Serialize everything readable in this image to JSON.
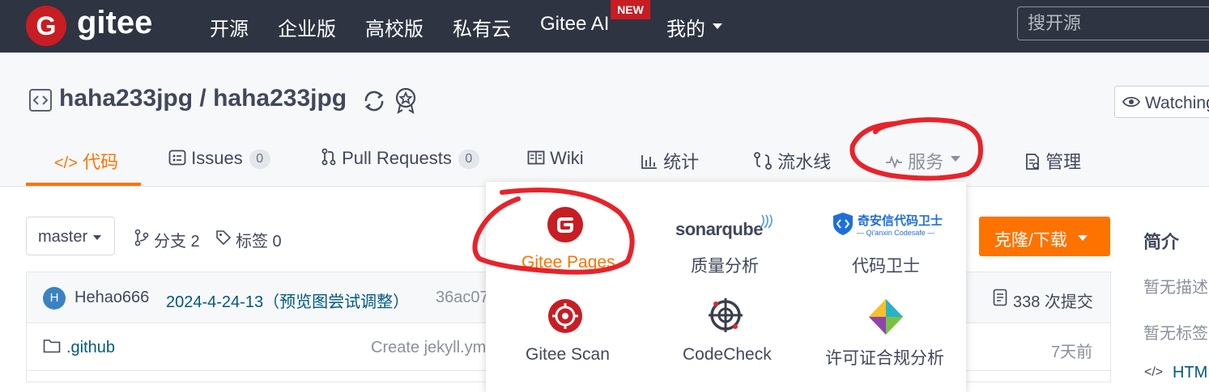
{
  "navbar": {
    "logo_letter": "G",
    "logo_text": "gitee",
    "items": [
      "开源",
      "企业版",
      "高校版",
      "私有云",
      "Gitee AI",
      "我的"
    ],
    "new_badge": "NEW",
    "search_placeholder": "搜开源"
  },
  "repo": {
    "title": "haha233jpg / haha233jpg",
    "watching_label": "Watching"
  },
  "tabs": [
    {
      "label": "代码",
      "active": true
    },
    {
      "label": "Issues",
      "count": "0"
    },
    {
      "label": "Pull Requests",
      "count": "0"
    },
    {
      "label": "Wiki"
    },
    {
      "label": "统计"
    },
    {
      "label": "流水线"
    },
    {
      "label": "服务"
    },
    {
      "label": "管理"
    }
  ],
  "toolbar": {
    "branch": "master",
    "branches_label": "分支 2",
    "tags_label": "标签 0",
    "clone_label": "克隆/下载"
  },
  "commit": {
    "avatar_letter": "H",
    "author": "Hehao666",
    "message": "2024-4-24-13（预览图尝试调整）",
    "hash": "36ac07",
    "count_label": "338 次提交"
  },
  "files": [
    {
      "name": ".github",
      "message": "Create jekyll.ym",
      "time": "7天前"
    }
  ],
  "sidebar": {
    "title": "简介",
    "no_description": "暂无描述",
    "no_tags": "暂无标签",
    "language": "HTM"
  },
  "services_menu": {
    "items": [
      {
        "label": "Gitee Pages",
        "icon": "gitee-pages-icon",
        "highlighted": true
      },
      {
        "label": "质量分析",
        "icon": "sonarqube-logo"
      },
      {
        "label": "代码卫士",
        "icon": "qianxin-codesafe-logo"
      },
      {
        "label": "Gitee Scan",
        "icon": "gitee-scan-icon"
      },
      {
        "label": "CodeCheck",
        "icon": "codecheck-icon"
      },
      {
        "label": "许可证合规分析",
        "icon": "license-compliance-icon"
      }
    ],
    "sonar_logo_text": "sonarqube",
    "codesafe_logo_text": "奇安信代码卫士",
    "codesafe_logo_subtext": "— Qi'anxin Codesafe —"
  },
  "colors": {
    "navbar_bg": "#2e3441",
    "brand_red": "#c71d23",
    "accent_orange": "#fe7300",
    "link_blue": "#005980",
    "annotation_red": "#e8232a"
  }
}
